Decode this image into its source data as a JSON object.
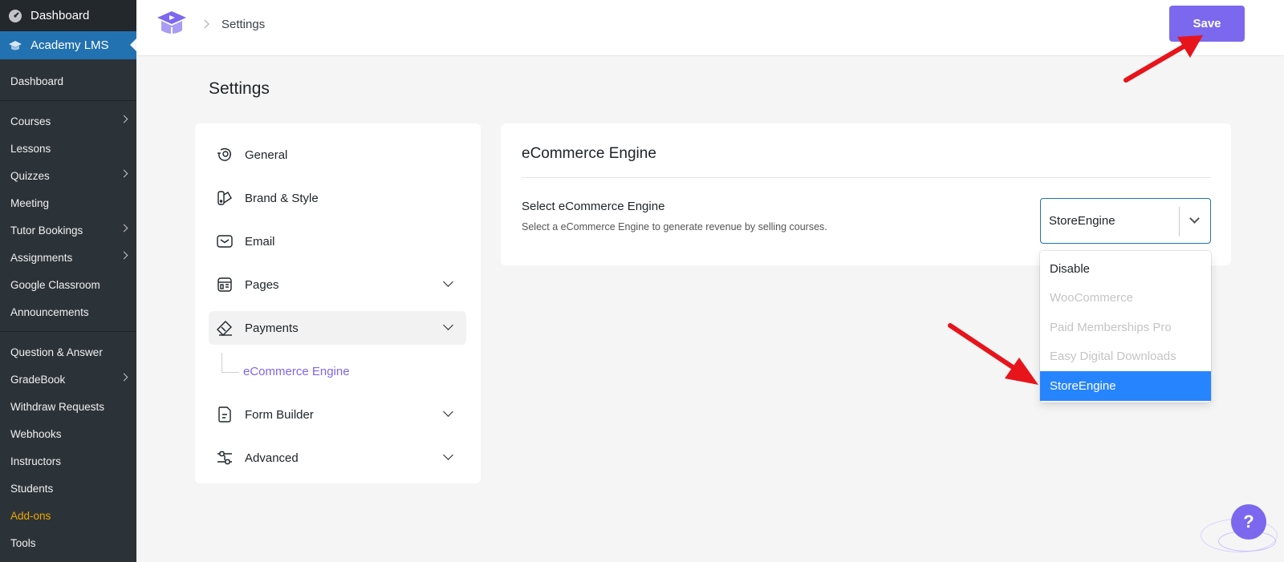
{
  "wp_menu": {
    "dashboard": "Dashboard",
    "active": "Academy LMS",
    "items": [
      {
        "label": "Dashboard",
        "chevron": false
      },
      {
        "label": "Courses",
        "chevron": true
      },
      {
        "label": "Lessons",
        "chevron": false
      },
      {
        "label": "Quizzes",
        "chevron": true
      },
      {
        "label": "Meeting",
        "chevron": false
      },
      {
        "label": "Tutor Bookings",
        "chevron": true
      },
      {
        "label": "Assignments",
        "chevron": true
      },
      {
        "label": "Google Classroom",
        "chevron": false
      },
      {
        "label": "Announcements",
        "chevron": false
      },
      {
        "label": "Question & Answer",
        "chevron": false
      },
      {
        "label": "GradeBook",
        "chevron": true
      },
      {
        "label": "Withdraw Requests",
        "chevron": false
      },
      {
        "label": "Webhooks",
        "chevron": false
      },
      {
        "label": "Instructors",
        "chevron": false
      },
      {
        "label": "Students",
        "chevron": false
      },
      {
        "label": "Add-ons",
        "chevron": false
      },
      {
        "label": "Tools",
        "chevron": false
      }
    ]
  },
  "header": {
    "breadcrumb": "Settings",
    "save_label": "Save"
  },
  "page": {
    "title": "Settings"
  },
  "settings_nav": {
    "items": [
      {
        "label": "General",
        "icon": "general-icon"
      },
      {
        "label": "Brand & Style",
        "icon": "brand-style-icon"
      },
      {
        "label": "Email",
        "icon": "email-icon"
      },
      {
        "label": "Pages",
        "icon": "pages-icon"
      },
      {
        "label": "Payments",
        "icon": "payments-icon"
      },
      {
        "label": "Form Builder",
        "icon": "form-builder-icon"
      },
      {
        "label": "Advanced",
        "icon": "advanced-icon"
      }
    ],
    "sub_item": "eCommerce Engine"
  },
  "content": {
    "title": "eCommerce Engine",
    "field_label": "Select eCommerce Engine",
    "field_desc": "Select a eCommerce Engine to generate revenue by selling courses.",
    "selected_value": "StoreEngine",
    "options": [
      {
        "label": "Disable",
        "state": "enabled"
      },
      {
        "label": "WooCommerce",
        "state": "disabled"
      },
      {
        "label": "Paid Memberships Pro",
        "state": "disabled"
      },
      {
        "label": "Easy Digital Downloads",
        "state": "disabled"
      },
      {
        "label": "StoreEngine",
        "state": "selected"
      }
    ]
  },
  "help": {
    "label": "?"
  },
  "colors": {
    "accent": "#7b68ee",
    "wp_sidebar": "#23282d",
    "wp_active": "#2271b1",
    "option_selected": "#2684ff",
    "annotation_arrow": "#e8141b"
  }
}
